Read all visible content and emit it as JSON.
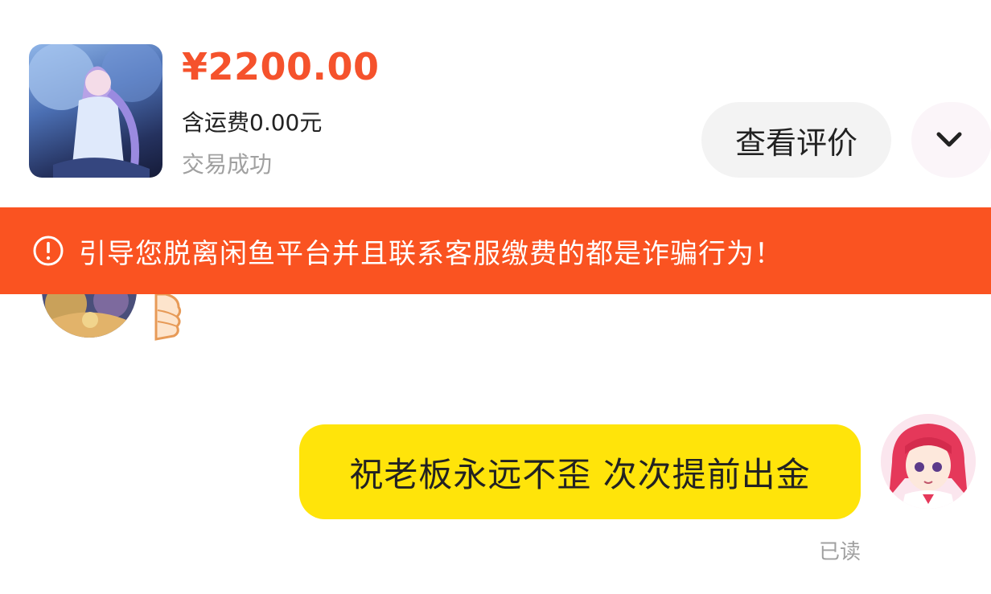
{
  "product": {
    "price": "¥2200.00",
    "shipping": "含运费0.00元",
    "status": "交易成功",
    "image_icon": "product-thumbnail"
  },
  "actions": {
    "review_label": "查看评价",
    "expand_icon": "chevron-down-icon"
  },
  "warning": {
    "icon": "exclamation-circle-icon",
    "text": "引导您脱离闲鱼平台并且联系客服缴费的都是诈骗行为！"
  },
  "chat": {
    "messages": [
      {
        "sender": "me",
        "text": "祝老板永远不歪 次次提前出金",
        "read_status": "已读"
      }
    ]
  },
  "colors": {
    "price": "#f5522c",
    "banner": "#fa5321",
    "my_bubble": "#ffe40a",
    "muted_text": "#a0a0a0"
  }
}
